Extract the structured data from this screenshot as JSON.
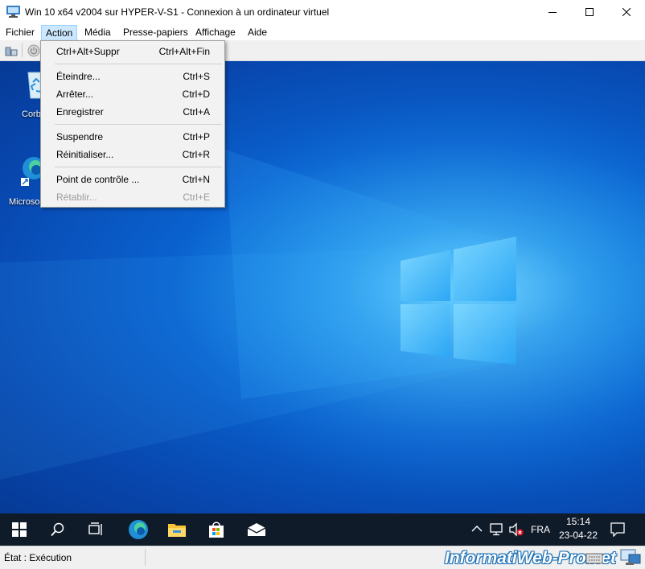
{
  "window": {
    "title": "Win 10 x64 v2004 sur HYPER-V-S1 - Connexion à un ordinateur virtuel",
    "app_icon": "vm-connection-icon",
    "controls": [
      "minimize-icon",
      "maximize-icon",
      "close-icon"
    ]
  },
  "menubar": {
    "items": [
      "Fichier",
      "Action",
      "Média",
      "Presse-papiers",
      "Affichage",
      "Aide"
    ],
    "active": "Action"
  },
  "toolbar": {
    "icons": [
      "ctrl-alt-del-icon",
      "power-icon"
    ]
  },
  "action_menu": {
    "groups": [
      [
        {
          "label": "Ctrl+Alt+Suppr",
          "shortcut": "Ctrl+Alt+Fin",
          "enabled": true
        }
      ],
      [
        {
          "label": "Éteindre...",
          "shortcut": "Ctrl+S",
          "enabled": true
        },
        {
          "label": "Arrêter...",
          "shortcut": "Ctrl+D",
          "enabled": true
        },
        {
          "label": "Enregistrer",
          "shortcut": "Ctrl+A",
          "enabled": true
        }
      ],
      [
        {
          "label": "Suspendre",
          "shortcut": "Ctrl+P",
          "enabled": true
        },
        {
          "label": "Réinitialiser...",
          "shortcut": "Ctrl+R",
          "enabled": true
        }
      ],
      [
        {
          "label": "Point de contrôle ...",
          "shortcut": "Ctrl+N",
          "enabled": true
        },
        {
          "label": "Rétablir...",
          "shortcut": "Ctrl+E",
          "enabled": false
        }
      ]
    ]
  },
  "desktop": {
    "icons": [
      {
        "label": "Corb",
        "icon": "recycle-bin-icon"
      },
      {
        "label": "Microso",
        "icon": "edge-shortcut-icon"
      }
    ]
  },
  "taskbar": {
    "buttons": [
      "windows-start-icon",
      "search-icon",
      "task-view-icon",
      "edge-icon",
      "file-explorer-icon",
      "store-icon",
      "mail-icon"
    ],
    "tray": {
      "icons": [
        "chevron-up-icon",
        "network-icon",
        "volume-muted-icon"
      ],
      "language": "FRA",
      "time": "15:14",
      "date": "23-04-22",
      "notification_icon": "action-center-icon"
    }
  },
  "statusbar": {
    "state": "État : Exécution",
    "watermark": "InformatiWeb-Pro.net",
    "icons": [
      "keyboard-icon",
      "enhanced-session-icon"
    ]
  },
  "colors": {
    "menu_highlight": "#cce8ff",
    "taskbar": "#101b2a",
    "desktop_blue": "#0a62cf"
  }
}
